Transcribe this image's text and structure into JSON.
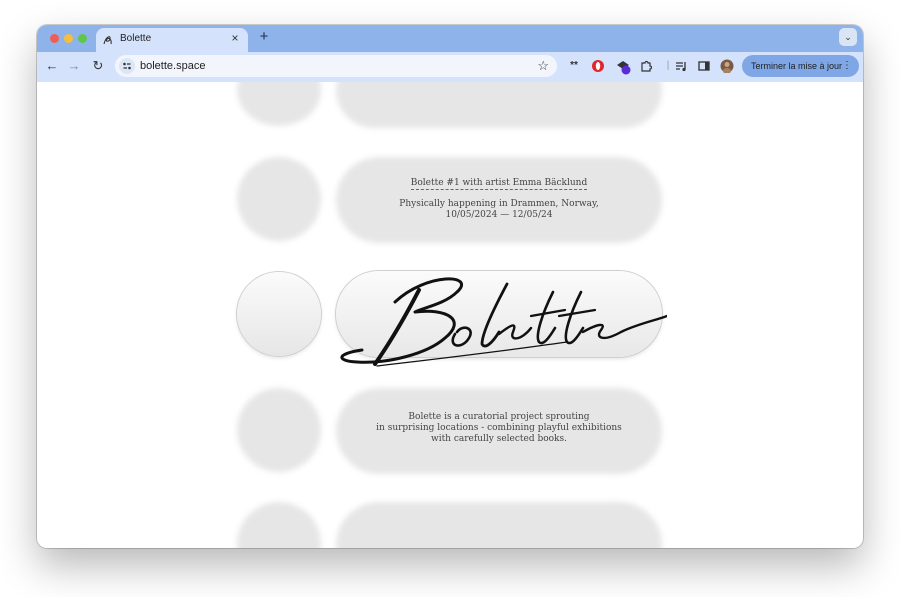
{
  "browser": {
    "tab": {
      "title": "Bolette",
      "favicon": "bolette-swirl-icon"
    },
    "url": "bolette.space",
    "update_button": "Terminer la mise à jour",
    "extensions": [
      "asterisk-icon",
      "opera-icon",
      "extension-badge-icon",
      "puzzle-icon",
      "media-icon",
      "side-panel-icon",
      "profile-avatar"
    ]
  },
  "page": {
    "event_link": "Bolette #1 with artist Emma Bäcklund",
    "event_line2": "Physically happening in Drammen, Norway,",
    "event_line3": "10/05/2024 — 12/05/24",
    "logo_text": "Bolette",
    "about_line1": "Bolette is a curatorial project sprouting",
    "about_line2": "in surprising locations - combining playful exhibitions",
    "about_line3": "with carefully selected books."
  },
  "colors": {
    "tab_bar": "#8eb3ea",
    "toolbar": "#d4e3fb",
    "blob": "#e6e6e6",
    "text": "#444444"
  }
}
